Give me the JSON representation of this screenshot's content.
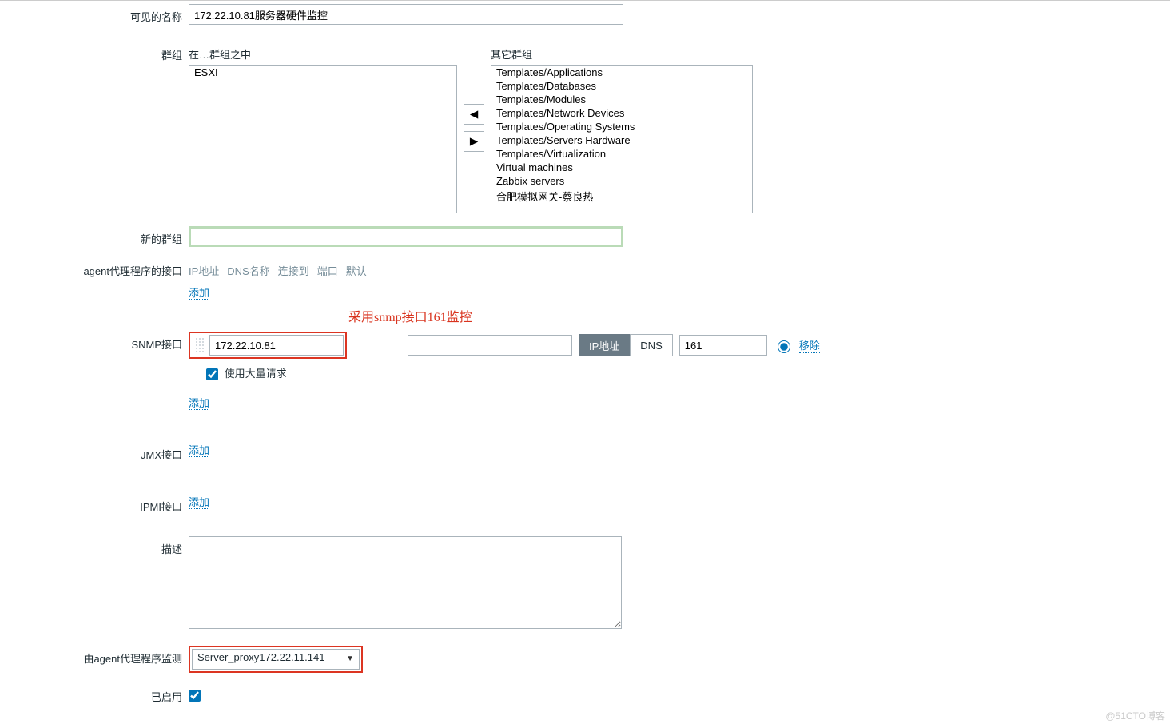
{
  "labels": {
    "visible_name": "可见的名称",
    "groups": "群组",
    "new_group": "新的群组",
    "agent_interface": "agent代理程序的接口",
    "snmp_interface": "SNMP接口",
    "jmx_interface": "JMX接口",
    "ipmi_interface": "IPMI接口",
    "description": "描述",
    "monitored_by_proxy": "由agent代理程序监测",
    "enabled": "已启用",
    "add": "添加",
    "remove": "移除"
  },
  "values": {
    "visible_name": "172.22.10.81服务器硬件监控",
    "proxy": "Server_proxy172.22.11.141"
  },
  "groups": {
    "in_label": "在…群组之中",
    "other_label": "其它群组",
    "in_items": [
      "ESXI"
    ],
    "other_items": [
      "Templates/Applications",
      "Templates/Databases",
      "Templates/Modules",
      "Templates/Network Devices",
      "Templates/Operating Systems",
      "Templates/Servers Hardware",
      "Templates/Virtualization",
      "Virtual machines",
      "Zabbix servers",
      "合肥模拟网关-蔡良热"
    ]
  },
  "interface_cols": {
    "ip": "IP地址",
    "dns": "DNS名称",
    "connect": "连接到",
    "port": "端口",
    "default": "默认"
  },
  "annotation": "采用snmp接口161监控",
  "snmp": {
    "ip": "172.22.10.81",
    "dns": "",
    "connect_ip": "IP地址",
    "connect_dns": "DNS",
    "port": "161",
    "bulk_label": "使用大量请求"
  },
  "watermark": "@51CTO博客"
}
